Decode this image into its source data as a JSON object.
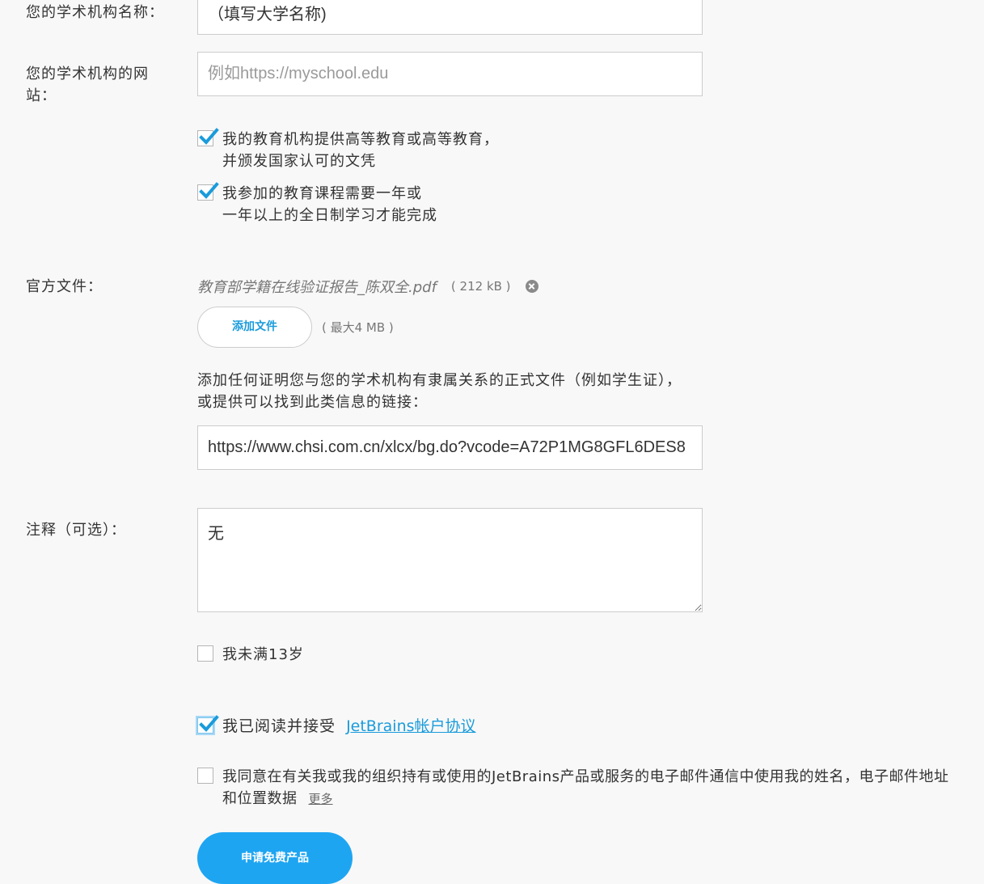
{
  "institution_name": {
    "label": "您的学术机构名称：",
    "value": "（填写大学名称)"
  },
  "institution_website": {
    "label": "您的学术机构的网站：",
    "placeholder": "例如https://myschool.edu"
  },
  "checkboxes": {
    "higher_education": {
      "line1": "我的教育机构提供高等教育或高等教育，",
      "line2": "并颁发国家认可的文凭",
      "checked": true
    },
    "full_time": {
      "line1": "我参加的教育课程需要一年或",
      "line2": "一年以上的全日制学习才能完成",
      "checked": true
    }
  },
  "official_documents": {
    "label": "官方文件：",
    "file_name": "教育部学籍在线验证报告_陈双全.pdf",
    "file_size": "( 212 kB )",
    "add_file_label": "添加文件",
    "max_size": "( 最大4 MB )",
    "help_text": "添加任何证明您与您的学术机构有隶属关系的正式文件（例如学生证），或提供可以找到此类信息的链接：",
    "link_value": "https://www.chsi.com.cn/xlcx/bg.do?vcode=A72P1MG8GFL6DES8"
  },
  "notes": {
    "label": "注释（可选）：",
    "value": "无"
  },
  "under_13": {
    "label": "我未满13岁",
    "checked": false
  },
  "agreement": {
    "prefix": "我已阅读并接受",
    "link": "JetBrains帐户协议",
    "checked": true
  },
  "consent": {
    "text": "我同意在有关我或我的组织持有或使用的JetBrains产品或服务的电子邮件通信中使用我的姓名，电子邮件地址和位置数据",
    "more": "更多",
    "checked": false
  },
  "submit_label": "申请免费产品",
  "colors": {
    "accent": "#1ea5f2",
    "link": "#1a9bdb",
    "check": "#1a9bdb",
    "background": "#f8f8f8"
  }
}
